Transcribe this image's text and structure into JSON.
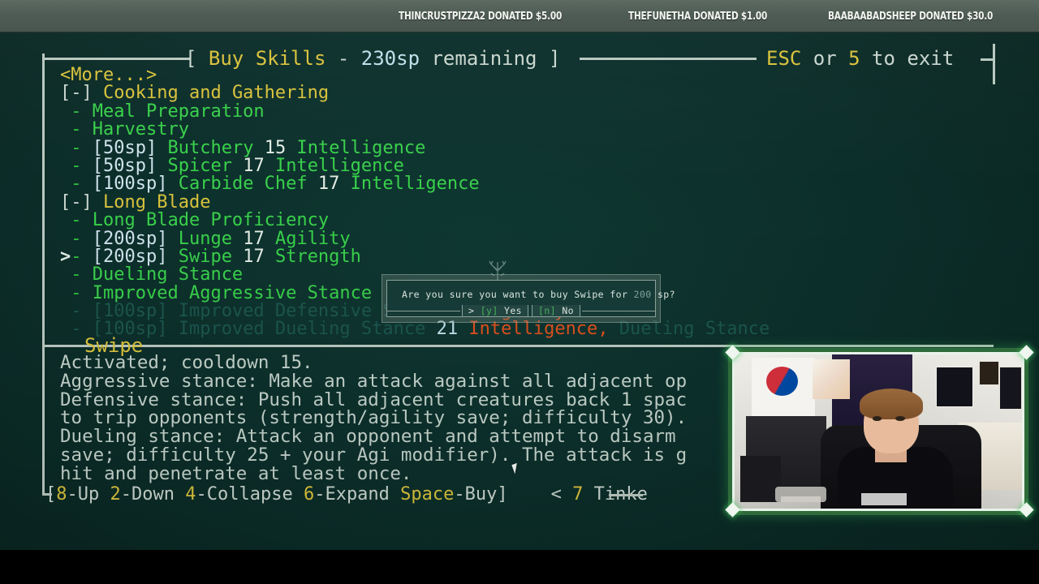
{
  "ticker": {
    "items": [
      "THINCRUSTPIZZA2 DONATED $5.00",
      "THEFUNETHA DONATED $1.00",
      "BAABAABADSHEEP DONATED $30.0"
    ]
  },
  "header": {
    "bracket_open": "[ ",
    "title": "Buy Skills",
    "dash": " - ",
    "points": "230sp",
    "remaining": " remaining",
    "bracket_close": " ]",
    "exit_key": "ESC",
    "exit_or": " or ",
    "exit_key2": "5",
    "exit_tail": " to exit"
  },
  "list": {
    "more_label": "<More...>",
    "cursor_glyph": ">",
    "rows": [
      {
        "indent": 0,
        "kind": "more",
        "text": "<More...>"
      },
      {
        "indent": 0,
        "kind": "category",
        "marker": "[-]",
        "name": "Cooking and Gathering"
      },
      {
        "indent": 1,
        "kind": "owned",
        "marker": "-",
        "name": "Meal Preparation"
      },
      {
        "indent": 1,
        "kind": "owned",
        "marker": "-",
        "name": "Harvestry"
      },
      {
        "indent": 1,
        "kind": "buyable",
        "marker": "-",
        "cost": "[50sp]",
        "name": "Butchery",
        "req_value": "15",
        "req_attr": "Intelligence",
        "req_met": true
      },
      {
        "indent": 1,
        "kind": "buyable",
        "marker": "-",
        "cost": "[50sp]",
        "name": "Spicer",
        "req_value": "17",
        "req_attr": "Intelligence",
        "req_met": true
      },
      {
        "indent": 1,
        "kind": "buyable",
        "marker": "-",
        "cost": "[100sp]",
        "name": "Carbide Chef",
        "req_value": "17",
        "req_attr": "Intelligence",
        "req_met": true
      },
      {
        "indent": 0,
        "kind": "category",
        "marker": "[-]",
        "name": "Long Blade"
      },
      {
        "indent": 1,
        "kind": "owned",
        "marker": "-",
        "name": "Long Blade Proficiency"
      },
      {
        "indent": 1,
        "kind": "buyable",
        "marker": "-",
        "cost": "[200sp]",
        "name": "Lunge",
        "req_value": "17",
        "req_attr": "Agility",
        "req_met": true
      },
      {
        "indent": 1,
        "kind": "buyable",
        "marker": "-",
        "cost": "[200sp]",
        "name": "Swipe",
        "req_value": "17",
        "req_attr": "Strength",
        "req_met": true,
        "selected": true
      },
      {
        "indent": 1,
        "kind": "owned",
        "marker": "-",
        "name": "Dueling Stance"
      },
      {
        "indent": 1,
        "kind": "owned",
        "marker": "-",
        "name": "Improved Aggressive Stance"
      },
      {
        "indent": 1,
        "kind": "locked",
        "marker": "-",
        "cost": "[100sp]",
        "name": "Improved Defensive Stance",
        "req_value": "23",
        "req_attr": "Agility",
        "req_met": false
      },
      {
        "indent": 1,
        "kind": "locked",
        "marker": "-",
        "cost": "[100sp]",
        "name": "Improved Dueling Stance",
        "req_value": "21",
        "req_attr": "Intelligence",
        "req_met": false,
        "req_extra": "Dueling Stance"
      }
    ]
  },
  "detail": {
    "title": "Swipe",
    "lines": [
      "Activated; cooldown 15.",
      "Aggressive stance: Make an attack against all adjacent op",
      "Defensive stance: Push all adjacent creatures back 1 spac",
      "to trip opponents (strength/agility save; difficulty 30).",
      "Dueling stance: Attack an opponent and attempt to disarm",
      "save; difficulty 25 + your Agi modifier). The attack is g",
      "hit and penetrate at least once."
    ]
  },
  "commandbar": {
    "open": "[",
    "keys": [
      {
        "key": "8",
        "label": "-Up"
      },
      {
        "key": "2",
        "label": "-Down"
      },
      {
        "key": "4",
        "label": "-Collapse"
      },
      {
        "key": "6",
        "label": "-Expand"
      },
      {
        "key": "Space",
        "label": "-Buy"
      }
    ],
    "close": "]",
    "arrow": "<",
    "next_key": "7",
    "next_label": " Tinke"
  },
  "dialog": {
    "message_prefix": "Are you sure you want to buy ",
    "message_skill": "Swipe",
    "message_mid": " for ",
    "message_cost": "200",
    "message_suffix": " sp?",
    "caret": ">",
    "yes_key": "[y]",
    "yes_label": "Yes",
    "no_key": "[n]",
    "no_label": "No"
  },
  "colors": {
    "background": "#0c2e2a",
    "frame": "#b9c8c0",
    "title_yellow": "#d9c23c",
    "skill_green": "#2fc23f",
    "cost_blue": "#cfe3ec",
    "unmet_orange": "#e0501e",
    "locked_dim": "#1c564e",
    "ticker_bar": "#4e5b54",
    "webcam_border": "#2f6b3a"
  }
}
